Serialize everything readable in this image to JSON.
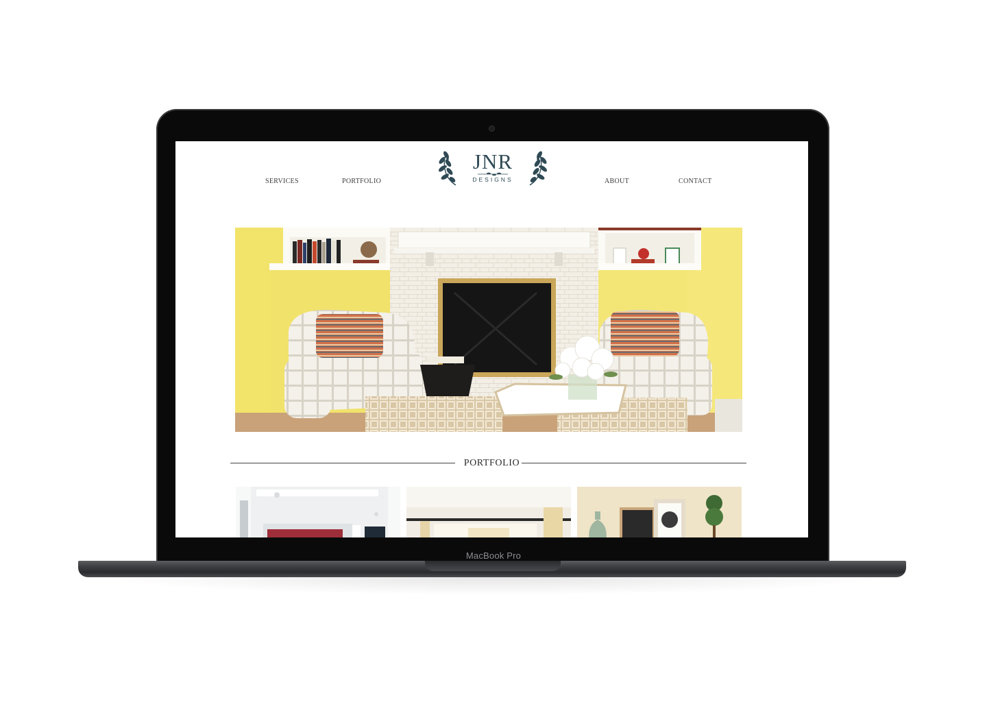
{
  "device": {
    "label": "MacBook Pro"
  },
  "site": {
    "logo": {
      "main": "JNR",
      "sub": "DESIGNS"
    },
    "nav": {
      "services": "SERVICES",
      "portfolio": "PORTFOLIO",
      "about": "ABOUT",
      "contact": "CONTACT"
    },
    "section_title": "PORTFOLIO"
  },
  "colors": {
    "brand": "#2f4a55",
    "wall": "#f2e36a",
    "screen_bg": "#ffffff"
  }
}
